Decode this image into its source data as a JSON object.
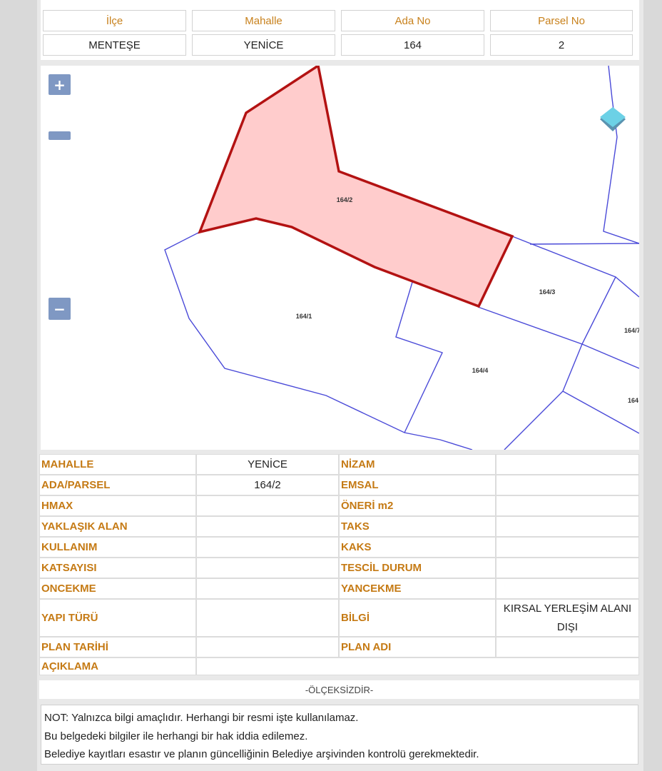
{
  "header": {
    "columns": [
      "İlçe",
      "Mahalle",
      "Ada No",
      "Parsel No"
    ],
    "values": [
      "MENTEŞE",
      "YENİCE",
      "164",
      "2"
    ]
  },
  "map": {
    "zoom_in_label": "+",
    "zoom_out_label": "−",
    "parcel_labels": {
      "p164_2": "164/2",
      "p164_1": "164/1",
      "p164_3": "164/3",
      "p164_4": "164/4",
      "p164_7": "164/7",
      "p164_x": "164"
    },
    "colors": {
      "selected_fill": "#ffcccc",
      "selected_stroke": "#b31212",
      "parcel_stroke": "#4a4ad8",
      "zoom_button": "#7f98c3"
    }
  },
  "info": {
    "rows": [
      {
        "l1": "MAHALLE",
        "v1": "YENİCE",
        "l2": "NİZAM",
        "v2": ""
      },
      {
        "l1": "ADA/PARSEL",
        "v1": "164/2",
        "l2": "EMSAL",
        "v2": ""
      },
      {
        "l1": "HMAX",
        "v1": "",
        "l2": "ÖNERİ m2",
        "v2": ""
      },
      {
        "l1": "YAKLAŞIK ALAN",
        "v1": "",
        "l2": "TAKS",
        "v2": ""
      },
      {
        "l1": "KULLANIM",
        "v1": "",
        "l2": "KAKS",
        "v2": ""
      },
      {
        "l1": "KATSAYISI",
        "v1": "",
        "l2": "TESCİL DURUM",
        "v2": ""
      },
      {
        "l1": "ONCEKME",
        "v1": "",
        "l2": "YANCEKME",
        "v2": ""
      },
      {
        "l1": "YAPI TÜRÜ",
        "v1": "",
        "l2": "BİLGİ",
        "v2": "KIRSAL YERLEŞİM ALANI DIŞI"
      },
      {
        "l1": "PLAN TARİHİ",
        "v1": "",
        "l2": "PLAN ADI",
        "v2": ""
      }
    ],
    "aciklama_label": "AÇIKLAMA",
    "aciklama_value": ""
  },
  "scale_text": "-ÖLÇEKSİZDİR-",
  "note": {
    "line1": "NOT: Yalnızca bilgi amaçlıdır. Herhangi bir resmi işte kullanılamaz.",
    "line2": "Bu belgedeki bilgiler ile herhangi bir hak iddia edilemez.",
    "line3": "Belediye kayıtları esastır ve planın güncelliğinin Belediye arşivinden kontrolü gerekmektedir."
  }
}
